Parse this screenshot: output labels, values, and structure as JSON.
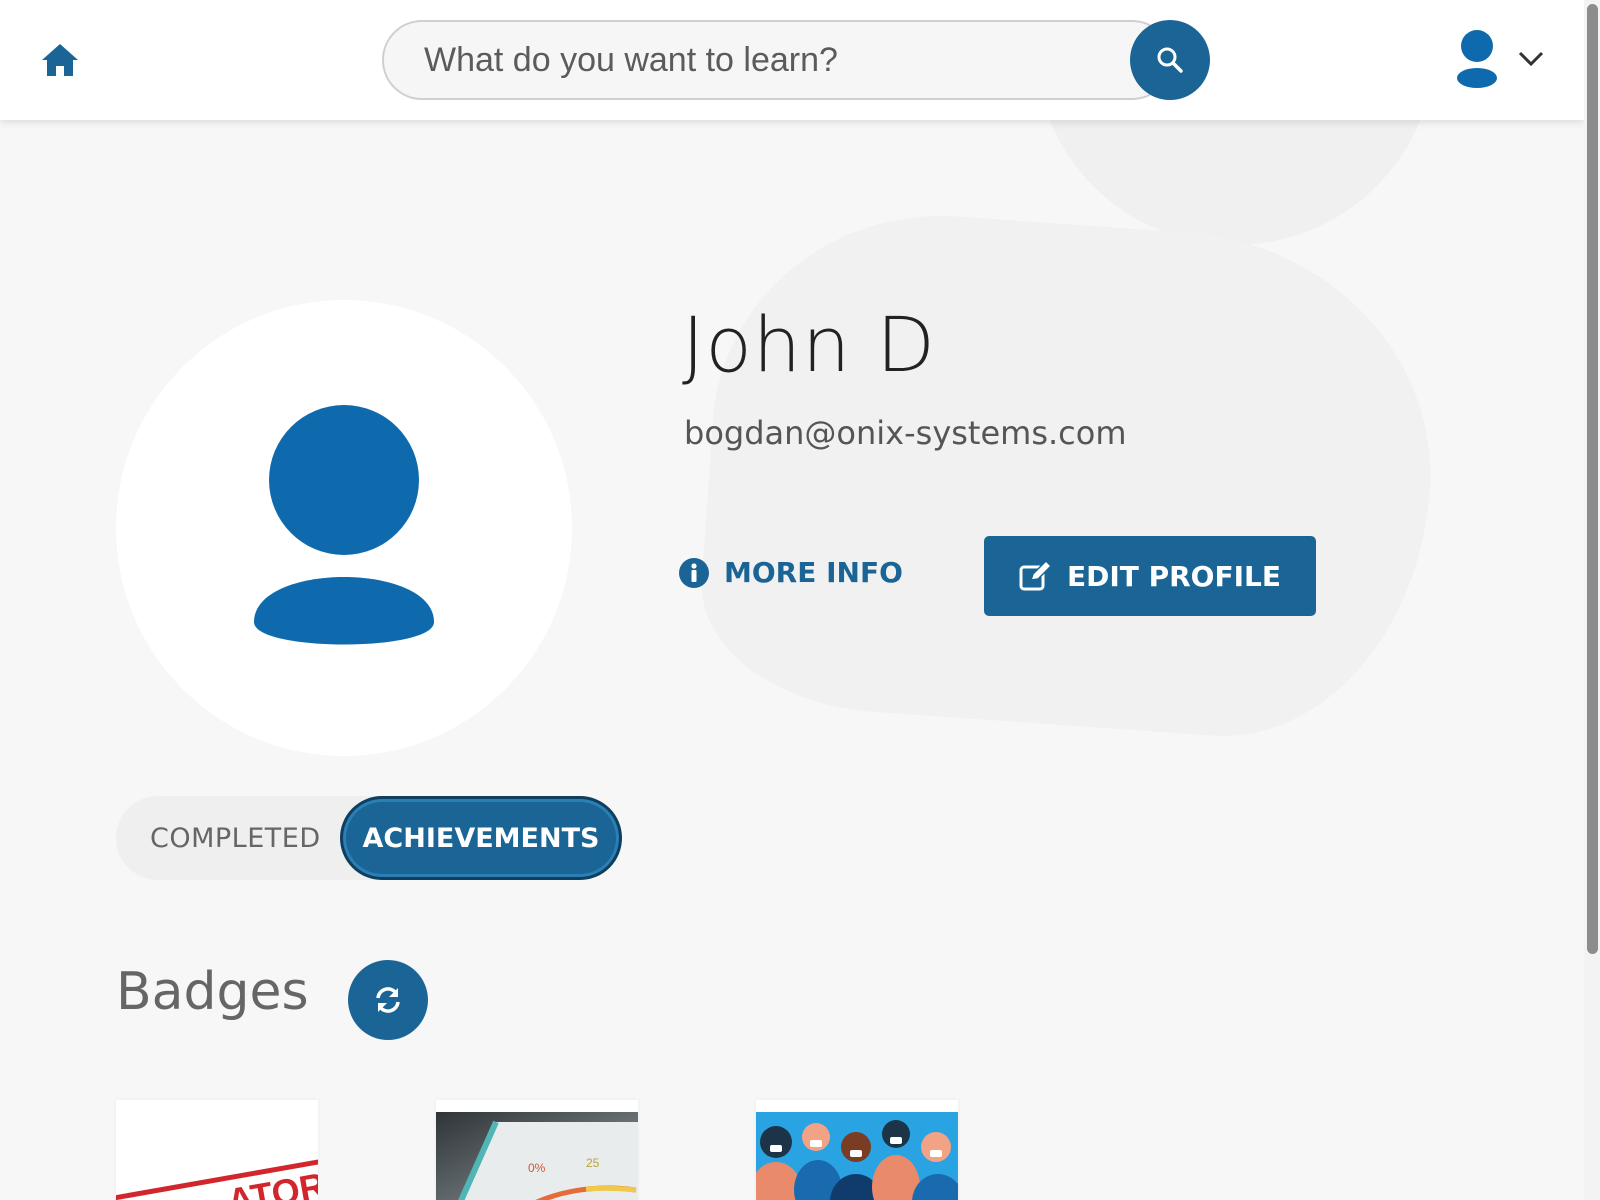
{
  "header": {
    "home_icon": "home-icon",
    "search": {
      "placeholder": "What do you want to learn?",
      "value": "",
      "icon": "search-icon"
    },
    "user_menu": {
      "avatar_icon": "user-icon",
      "chevron_icon": "chevron-down-icon"
    }
  },
  "profile": {
    "name": "John D",
    "email": "bogdan@onix-systems.com",
    "more_info_label": "MORE INFO",
    "edit_profile_label": "EDIT PROFILE"
  },
  "tabs": [
    {
      "label": "COMPLETED",
      "active": false
    },
    {
      "label": "ACHIEVEMENTS",
      "active": true
    }
  ],
  "badges": {
    "title": "Badges",
    "refresh_icon": "refresh-icon",
    "items": [
      {
        "image": "mandatory-stamp-image",
        "stamp_text": "ATORY"
      },
      {
        "image": "gauge-meter-image",
        "gauge_labels": [
          "0%",
          "25"
        ]
      },
      {
        "image": "crowd-masks-image"
      }
    ]
  },
  "colors": {
    "primary": "#1a6595",
    "avatar_blue": "#0f6aad",
    "background": "#f7f7f7"
  }
}
